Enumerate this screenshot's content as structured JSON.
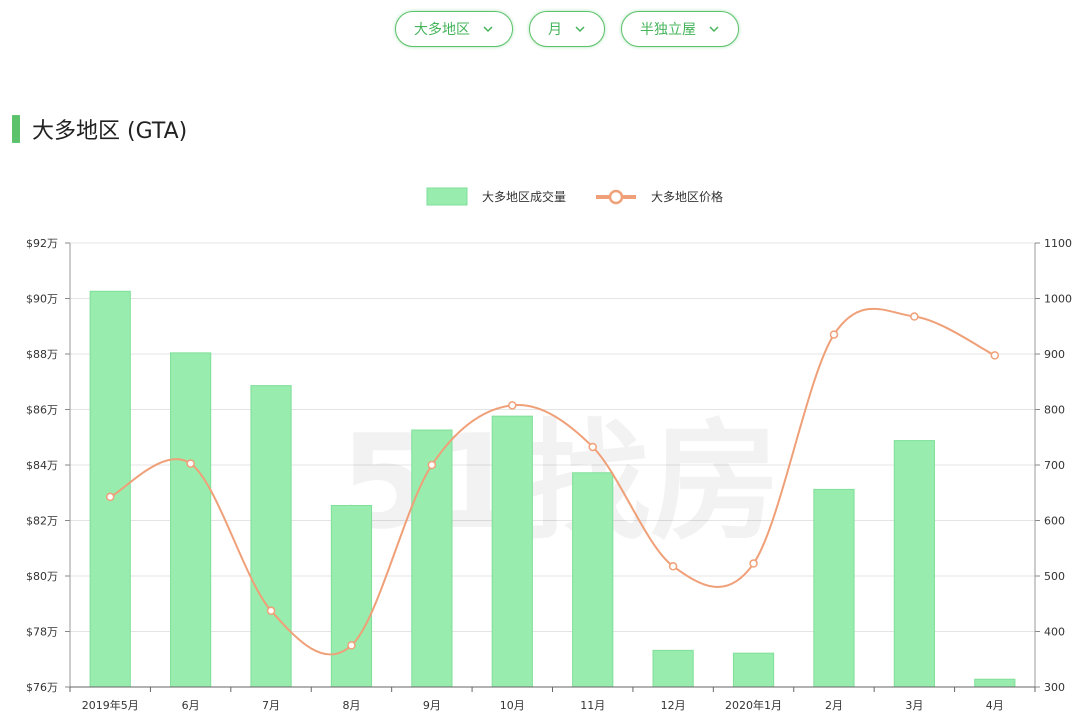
{
  "filters": {
    "region": "大多地区",
    "period": "月",
    "property_type": "半独立屋"
  },
  "section_title": "大多地区 (GTA)",
  "watermark": "51找房",
  "colors": {
    "accent": "#5cc36c",
    "bar": "#98ecae",
    "bar_border": "#7fdf98",
    "line": "#f0a078",
    "grid": "#e4e4e4"
  },
  "chart_data": {
    "type": "bar",
    "categories": [
      "2019年5月",
      "6月",
      "7月",
      "8月",
      "9月",
      "10月",
      "11月",
      "12月",
      "2020年1月",
      "2月",
      "3月",
      "4月"
    ],
    "series": [
      {
        "name": "大多地区成交量",
        "type": "bar",
        "axis": "right",
        "values": [
          1013,
          902,
          843,
          627,
          763,
          788,
          686,
          366,
          361,
          656,
          744,
          314
        ]
      },
      {
        "name": "大多地区价格",
        "type": "line",
        "smooth": true,
        "axis": "left",
        "values": [
          82.85,
          84.05,
          78.75,
          77.5,
          84.0,
          86.15,
          84.65,
          80.35,
          80.45,
          88.7,
          89.35,
          87.95
        ]
      }
    ],
    "y_left": {
      "ticks": [
        "$76万",
        "$78万",
        "$80万",
        "$82万",
        "$84万",
        "$86万",
        "$88万",
        "$90万",
        "$92万"
      ],
      "range": [
        76,
        92
      ]
    },
    "y_right": {
      "ticks": [
        "300",
        "400",
        "500",
        "600",
        "700",
        "800",
        "900",
        "1000",
        "1100"
      ],
      "range": [
        300,
        1100
      ]
    },
    "legend_position": "top-center",
    "grid": true
  }
}
